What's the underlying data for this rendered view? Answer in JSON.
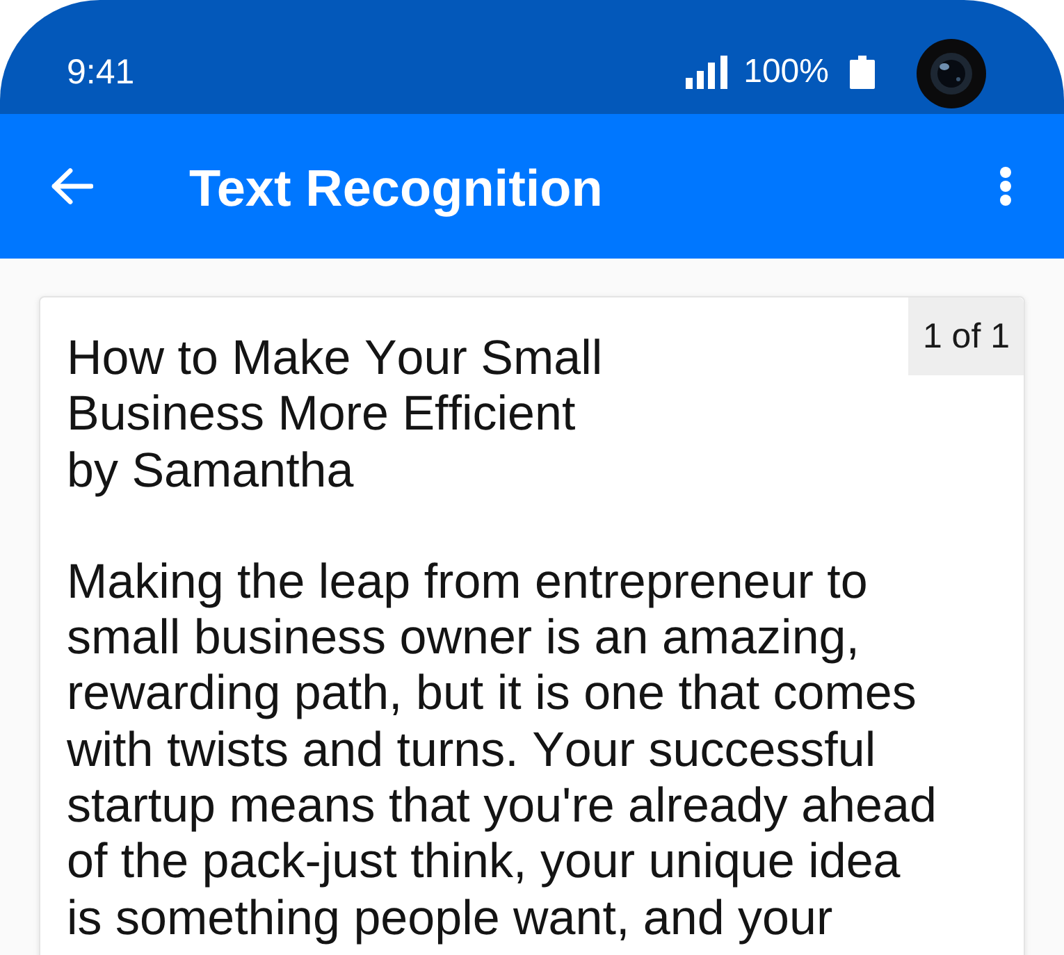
{
  "status_bar": {
    "time": "9:41",
    "battery": "100%"
  },
  "app_bar": {
    "title": "Text Recognition"
  },
  "result": {
    "page_indicator": "1 of 1",
    "title": "How to Make Your Small Business More Efficient",
    "author": "by Samantha",
    "body": "Making the leap from entrepreneur to small business owner is an amazing, rewarding path, but it is one that comes with twists and turns. Your successful startup means that you're already ahead of the pack-just think, your unique idea is something people want, and your"
  }
}
